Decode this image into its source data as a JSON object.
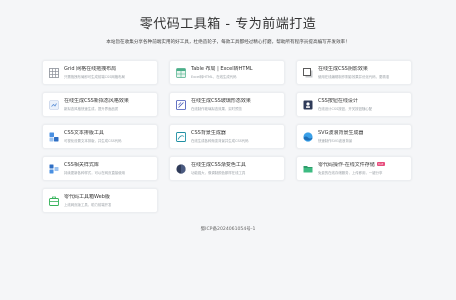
{
  "header": {
    "title": "零代码工具箱 - 专为前端打造",
    "subtitle": "本站旨在收集分享各种前端实用的好工具，杜绝造轮子，每款工具都经过精心打磨，帮助所有程序员提高编写开发效率！"
  },
  "tools": [
    {
      "name": "Grid 网格在线拖拽布局",
      "desc": "只需拖拽布局即可生成前端CSS网格布局",
      "icon": "grid-icon"
    },
    {
      "name": "Table 布局 | Excel转HTML",
      "desc": "Excel转HTML，在线生成代码",
      "icon": "table-icon"
    },
    {
      "name": "在线生成CSS阴影效果",
      "desc": "使用在线编辑制作阴影效果并优化代码，更精准",
      "icon": "shadow-icon"
    },
    {
      "name": "在线生成CSS新拟态风格效果",
      "desc": "新拟态风格快速生成，提升界面品质",
      "icon": "neumorphism-icon"
    },
    {
      "name": "在线生成CSS玻璃形态效果",
      "desc": "在线制作玻璃拟态效果，实时预览",
      "icon": "glass-icon"
    },
    {
      "name": "CSS按钮在线设计",
      "desc": "在线设计CSS按钮，开关按钮随心配",
      "icon": "button-icon"
    },
    {
      "name": "CSS文本排版工具",
      "desc": "可视化设置文本排版，并生成CSS代码",
      "icon": "text-icon"
    },
    {
      "name": "CSS背景生成器",
      "desc": "在线生成各种渐变背景并生成CSS代码",
      "icon": "background-icon"
    },
    {
      "name": "SVG波浪背景生成器",
      "desc": "快速制作SVG波浪背景",
      "icon": "wave-icon"
    },
    {
      "name": "CSS相关样式库",
      "desc": "持续更新各种样式，可以在网页直接使用",
      "icon": "library-icon"
    },
    {
      "name": "在线生成CSS渐变色工具",
      "desc": "功能强大，像调制颜色那样在线工具",
      "icon": "gradient-icon"
    },
    {
      "name": "零代码操作-在线文件存储",
      "badge": "hot",
      "desc": "免费的在线存储服务，上传即用，一键分享",
      "icon": "folder-icon"
    },
    {
      "name": "零代码工具箱Web版",
      "desc": "上线网页版工具，助力前端开发",
      "icon": "toolbox-icon"
    }
  ],
  "footer": {
    "icp": "蜀ICP备2024061054号-1"
  },
  "colors": {
    "background": "#f5f6f8",
    "card": "#ffffff",
    "badge": "#e74c7c",
    "muted_text": "#9aa0a6"
  }
}
